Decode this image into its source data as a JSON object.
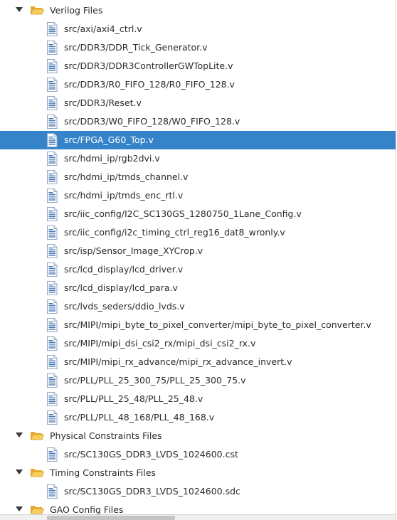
{
  "tree": {
    "groups": [
      {
        "label": "Verilog Files",
        "expanded": true,
        "files": [
          "src/axi/axi4_ctrl.v",
          "src/DDR3/DDR_Tick_Generator.v",
          "src/DDR3/DDR3ControllerGWTopLite.v",
          "src/DDR3/R0_FIFO_128/R0_FIFO_128.v",
          "src/DDR3/Reset.v",
          "src/DDR3/W0_FIFO_128/W0_FIFO_128.v",
          "src/FPGA_G60_Top.v",
          "src/hdmi_ip/rgb2dvi.v",
          "src/hdmi_ip/tmds_channel.v",
          "src/hdmi_ip/tmds_enc_rtl.v",
          "src/iic_config/I2C_SC130GS_1280750_1Lane_Config.v",
          "src/iic_config/i2c_timing_ctrl_reg16_dat8_wronly.v",
          "src/isp/Sensor_Image_XYCrop.v",
          "src/lcd_display/lcd_driver.v",
          "src/lcd_display/lcd_para.v",
          "src/lvds_seders/ddio_lvds.v",
          "src/MIPI/mipi_byte_to_pixel_converter/mipi_byte_to_pixel_converter.v",
          "src/MIPI/mipi_dsi_csi2_rx/mipi_dsi_csi2_rx.v",
          "src/MIPI/mipi_rx_advance/mipi_rx_advance_invert.v",
          "src/PLL/PLL_25_300_75/PLL_25_300_75.v",
          "src/PLL/PLL_25_48/PLL_25_48.v",
          "src/PLL/PLL_48_168/PLL_48_168.v"
        ]
      },
      {
        "label": "Physical Constraints Files",
        "expanded": true,
        "files": [
          "src/SC130GS_DDR3_LVDS_1024600.cst"
        ]
      },
      {
        "label": "Timing Constraints Files",
        "expanded": true,
        "files": [
          "src/SC130GS_DDR3_LVDS_1024600.sdc"
        ]
      },
      {
        "label": "GAO Config Files",
        "expanded": true,
        "files": []
      }
    ],
    "selected_file": "src/FPGA_G60_Top.v"
  },
  "colors": {
    "selection": "#3584c9",
    "folder": "#f4c24d",
    "file_icon_lines": "#3b6fb0"
  },
  "icons": {
    "group_icon": "folder-open-icon",
    "file_icon": "text-file-icon",
    "expander": "expand-arrow-icon"
  }
}
